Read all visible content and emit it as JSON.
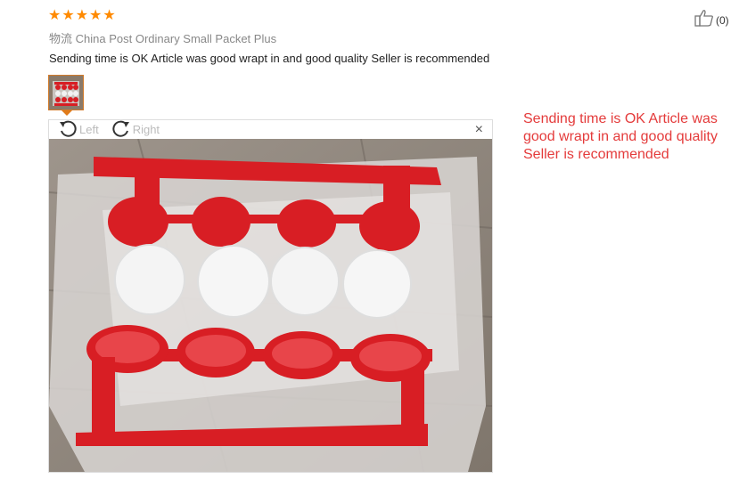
{
  "review": {
    "rating": 5,
    "stars": [
      "★",
      "★",
      "★",
      "★",
      "★"
    ],
    "logistics_label": "物流",
    "logistics_value": "China Post Ordinary Small Packet Plus",
    "text": "Sending time is OK Article was good wrapt in and good quality Seller is recommended",
    "like_count": "(0)"
  },
  "viewer": {
    "rotate_left_label": "Left",
    "rotate_right_label": "Right",
    "close_label": "×"
  },
  "translation": {
    "text": "Sending time is OK Article was good wrapt in and good quality Seller is recommended"
  },
  "colors": {
    "star": "#ff8a00",
    "translation": "#e43b3b",
    "product_red": "#d81e24"
  }
}
